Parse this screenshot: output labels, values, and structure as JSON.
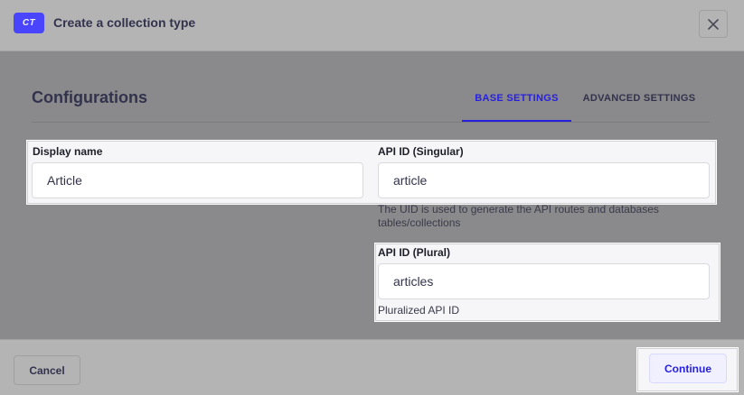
{
  "header": {
    "badge": "CT",
    "title": "Create a collection type",
    "close_icon": "close-icon"
  },
  "main": {
    "section_title": "Configurations",
    "tabs": [
      {
        "label": "BASE SETTINGS",
        "active": true
      },
      {
        "label": "ADVANCED SETTINGS",
        "active": false
      }
    ],
    "fields": {
      "display_name": {
        "label": "Display name",
        "value": "Article"
      },
      "api_id_singular": {
        "label": "API ID (Singular)",
        "value": "article",
        "hint": "The UID is used to generate the API routes and databases tables/collections"
      },
      "api_id_plural": {
        "label": "API ID (Plural)",
        "value": "articles",
        "hint": "Pluralized API ID"
      }
    }
  },
  "footer": {
    "cancel_label": "Cancel",
    "continue_label": "Continue"
  },
  "colors": {
    "accent": "#4945ff",
    "active_tab": "#271fe0",
    "overlay": "#8a8a8c"
  }
}
